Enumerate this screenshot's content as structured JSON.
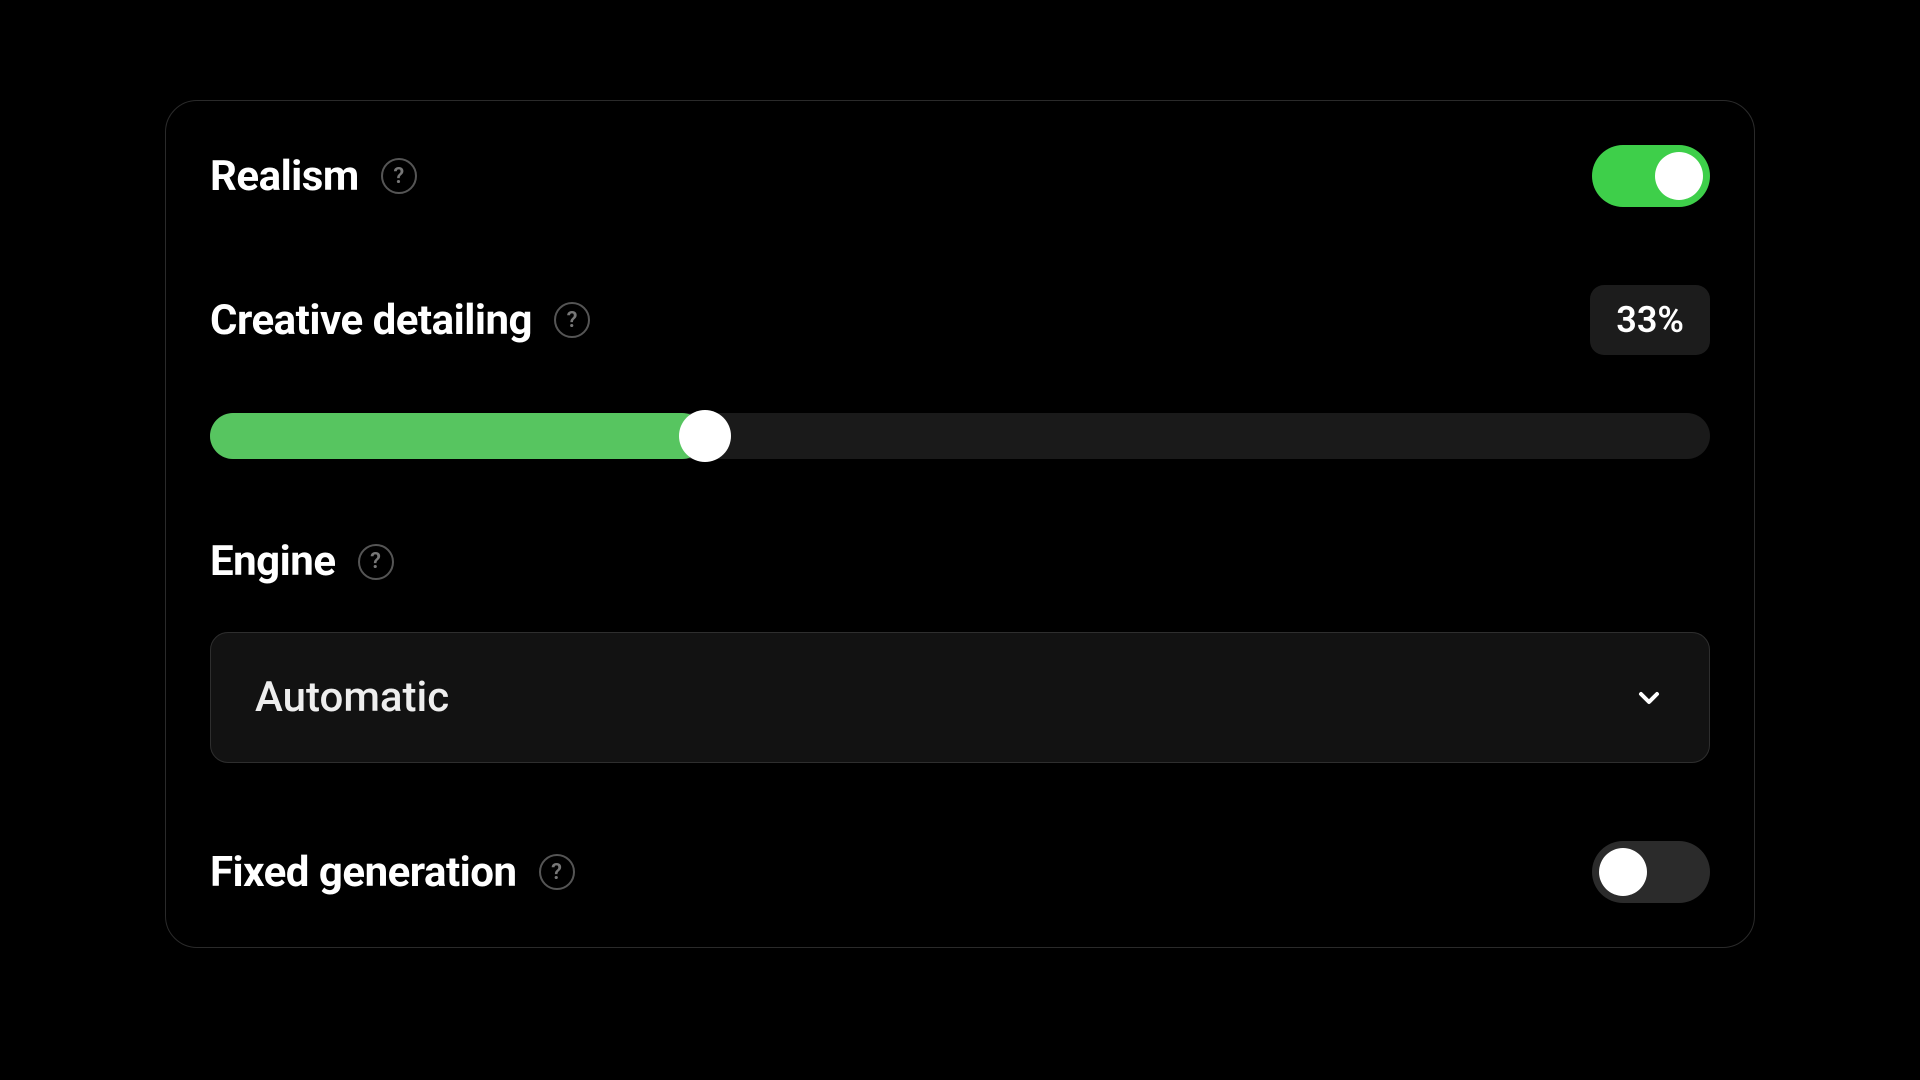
{
  "colors": {
    "accent_green": "#3ecf4a",
    "slider_green": "#57c560",
    "panel_border": "#2a2a2a",
    "badge_bg": "#1c1c1c",
    "select_bg": "#121212"
  },
  "settings": {
    "realism": {
      "label": "Realism",
      "help": "?",
      "enabled": true
    },
    "creative_detailing": {
      "label": "Creative detailing",
      "help": "?",
      "value_display": "33%",
      "value_percent": 33
    },
    "engine": {
      "label": "Engine",
      "help": "?",
      "selected": "Automatic"
    },
    "fixed_generation": {
      "label": "Fixed generation",
      "help": "?",
      "enabled": false
    }
  }
}
